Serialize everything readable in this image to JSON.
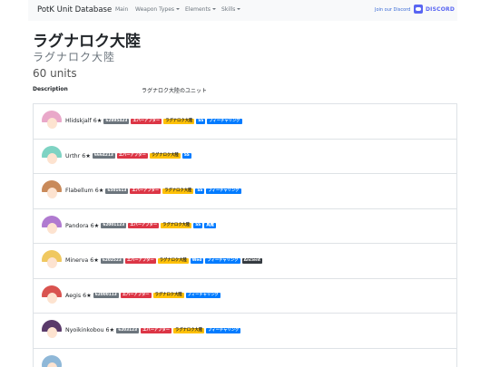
{
  "navbar": {
    "brand": "PotK Unit Database",
    "items": [
      {
        "label": "Main",
        "dropdown": false
      },
      {
        "label": "Weapon Types",
        "dropdown": true
      },
      {
        "label": "Elements",
        "dropdown": true
      },
      {
        "label": "Skills",
        "dropdown": true
      }
    ],
    "discord_text": "Join our Discord",
    "discord_word": "DISCORD"
  },
  "page": {
    "title": "ラグナロク大陸",
    "subtitle": "ラグナロク大陸",
    "units_count": "60 units",
    "description_label": "Description",
    "description_value": "ラグナロク大陸のユニット"
  },
  "badge_colors": {
    "secondary": "#6c757d",
    "danger": "#dc3545",
    "warning": "#ffc107",
    "primary": "#007bff",
    "dark": "#343a40"
  },
  "units": [
    {
      "name": "Hlidskjalf 6★",
      "hair": "#e9a8c9",
      "badges": [
        {
          "text": "62895423",
          "type": "secondary"
        },
        {
          "text": "エバーアフター",
          "type": "danger"
        },
        {
          "text": "ラグナロク大陸",
          "type": "warning"
        },
        {
          "text": "SS",
          "type": "primary"
        },
        {
          "text": "フィーチャリング",
          "type": "primary"
        }
      ]
    },
    {
      "name": "Urthr 6★",
      "hair": "#7ed3c3",
      "badges": [
        {
          "text": "6664213",
          "type": "secondary"
        },
        {
          "text": "エバーアフター",
          "type": "danger"
        },
        {
          "text": "ラグナロク大陸",
          "type": "warning"
        },
        {
          "text": "SS",
          "type": "primary"
        }
      ]
    },
    {
      "name": "Flabellum 6★",
      "hair": "#c98a5a",
      "badges": [
        {
          "text": "6501613",
          "type": "secondary"
        },
        {
          "text": "エバーアフター",
          "type": "danger"
        },
        {
          "text": "ラグナロク大陸",
          "type": "warning"
        },
        {
          "text": "SS",
          "type": "primary"
        },
        {
          "text": "フィーチャリング",
          "type": "primary"
        }
      ]
    },
    {
      "name": "Pandora 6★",
      "hair": "#b07ad0",
      "badges": [
        {
          "text": "62001123",
          "type": "secondary"
        },
        {
          "text": "エバーアフター",
          "type": "danger"
        },
        {
          "text": "ラグナロク大陸",
          "type": "warning"
        },
        {
          "text": "SS",
          "type": "primary"
        },
        {
          "text": "真魔",
          "type": "primary"
        }
      ]
    },
    {
      "name": "Minerva 6★",
      "hair": "#f0c860",
      "badges": [
        {
          "text": "6202523",
          "type": "secondary"
        },
        {
          "text": "エバーアフター",
          "type": "danger"
        },
        {
          "text": "ラグナロク大陸",
          "type": "warning"
        },
        {
          "text": "Wed",
          "type": "primary"
        },
        {
          "text": "フィーチャリング",
          "type": "primary"
        },
        {
          "text": "Ancient",
          "type": "dark"
        }
      ]
    },
    {
      "name": "Aegis 6★",
      "hair": "#d9534f",
      "badges": [
        {
          "text": "62000113",
          "type": "secondary"
        },
        {
          "text": "エバーアフター",
          "type": "danger"
        },
        {
          "text": "ラグナロク大陸",
          "type": "warning"
        },
        {
          "text": "フィーチャリング",
          "type": "primary"
        }
      ]
    },
    {
      "name": "Nyoikinkobou 6★",
      "hair": "#5a3a6a",
      "badges": [
        {
          "text": "6203123",
          "type": "secondary"
        },
        {
          "text": "エバーアフター",
          "type": "danger"
        },
        {
          "text": "ラグナロク大陸",
          "type": "warning"
        },
        {
          "text": "フィーチャリング",
          "type": "primary"
        }
      ]
    },
    {
      "name": "",
      "hair": "#8fb8d8",
      "badges": []
    }
  ]
}
